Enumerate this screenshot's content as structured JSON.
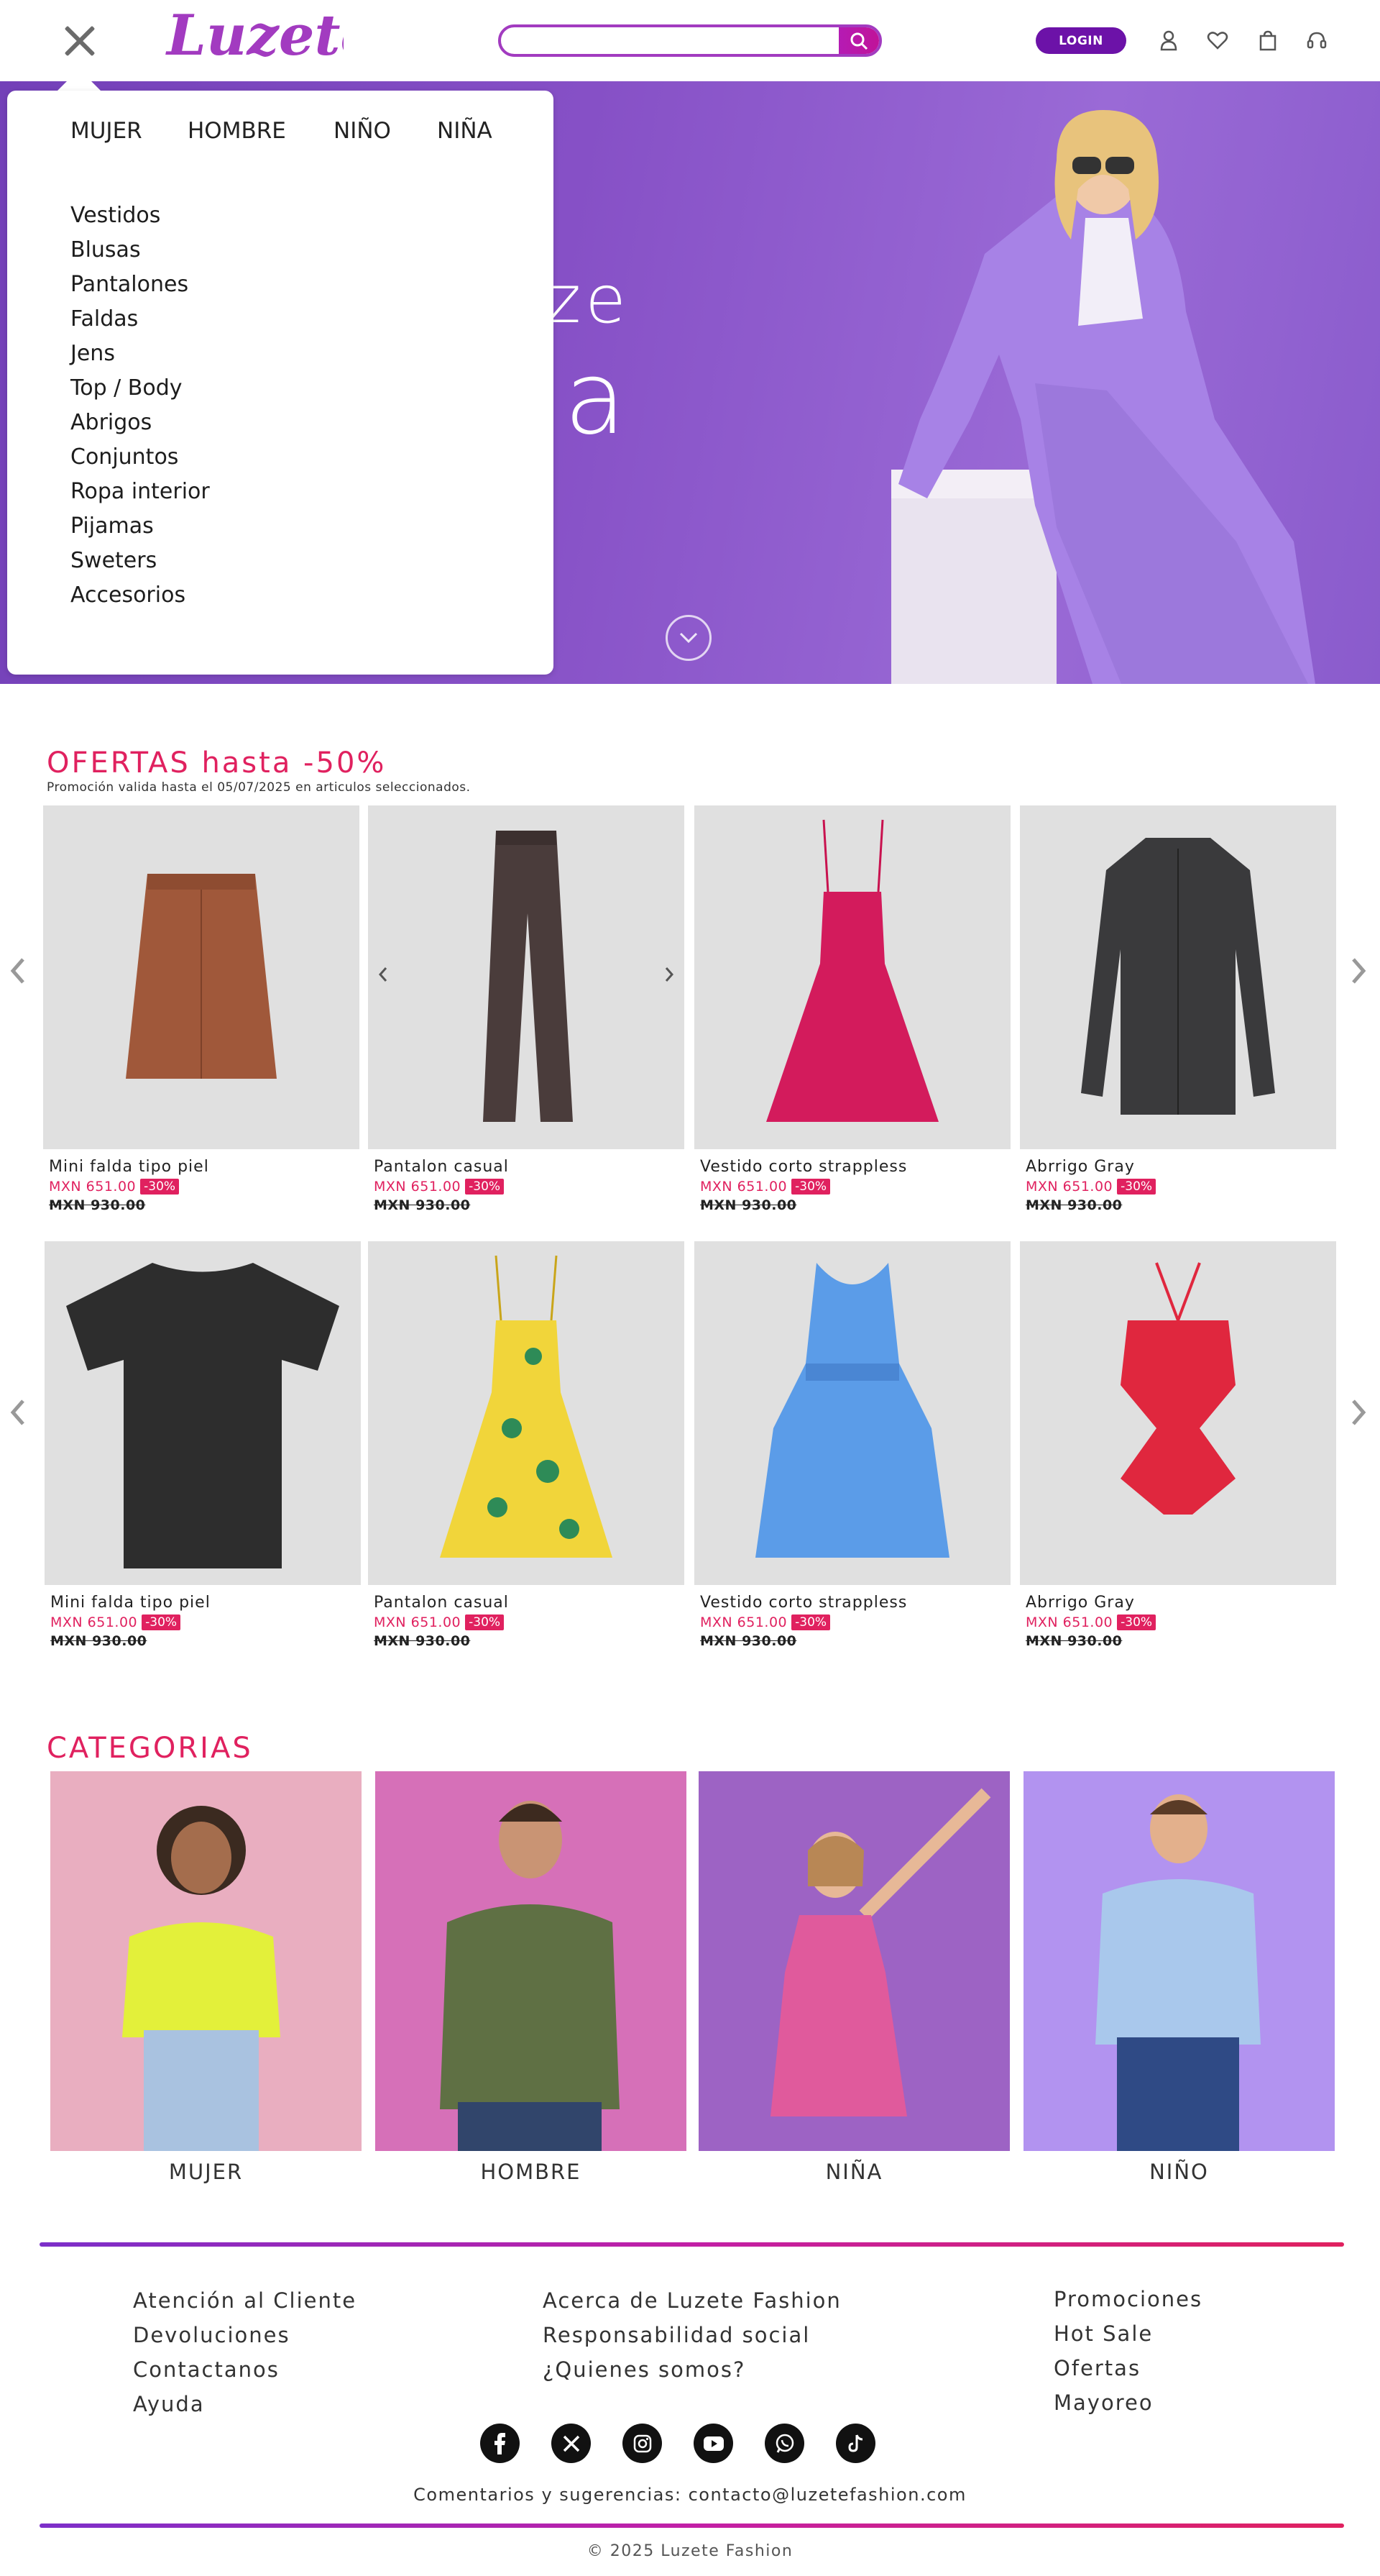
{
  "header": {
    "logo_text": "Luzete",
    "search": {
      "placeholder": "",
      "value": ""
    },
    "login_label": "LOGIN",
    "icons": [
      "user-icon",
      "heart-icon",
      "bag-icon",
      "headset-icon"
    ]
  },
  "hero": {
    "line1": "ze",
    "line2": "ia"
  },
  "menu": {
    "tabs": [
      "MUJER",
      "HOMBRE",
      "NIÑO",
      "NIÑA"
    ],
    "items": [
      "Vestidos",
      "Blusas",
      "Pantalones",
      "Faldas",
      "Jens",
      "Top / Body",
      "Abrigos",
      "Conjuntos",
      "Ropa interior",
      "Pijamas",
      "Sweters",
      "Accesorios"
    ]
  },
  "offers": {
    "title": "OFERTAS hasta -50%",
    "note": "Promoción valida hasta el 05/07/2025 en articulos seleccionados.",
    "row1": [
      {
        "name": "Mini falda tipo piel",
        "price": "MXN 651.00",
        "badge": "-30%",
        "old": "MXN 930.00"
      },
      {
        "name": "Pantalon casual",
        "price": "MXN 651.00",
        "badge": "-30%",
        "old": "MXN 930.00"
      },
      {
        "name": "Vestido corto strappless",
        "price": "MXN 651.00",
        "badge": "-30%",
        "old": "MXN 930.00"
      },
      {
        "name": "Abrrigo Gray",
        "price": "MXN 651.00",
        "badge": "-30%",
        "old": "MXN 930.00"
      }
    ],
    "row2": [
      {
        "name": "Mini falda tipo piel",
        "price": "MXN 651.00",
        "badge": "-30%",
        "old": "MXN 930.00"
      },
      {
        "name": "Pantalon casual",
        "price": "MXN 651.00",
        "badge": "-30%",
        "old": "MXN 930.00"
      },
      {
        "name": "Vestido corto strappless",
        "price": "MXN 651.00",
        "badge": "-30%",
        "old": "MXN 930.00"
      },
      {
        "name": "Abrrigo Gray",
        "price": "MXN 651.00",
        "badge": "-30%",
        "old": "MXN 930.00"
      }
    ]
  },
  "categories": {
    "title": "CATEGORIAS",
    "items": [
      "MUJER",
      "HOMBRE",
      "NIÑA",
      "NIÑO"
    ]
  },
  "footer": {
    "col1": [
      "Atención al Cliente",
      "Devoluciones",
      "Contactanos",
      "Ayuda"
    ],
    "col2": [
      "Acerca de Luzete Fashion",
      "Responsabilidad social",
      "¿Quienes somos?"
    ],
    "col3": [
      "Promociones",
      "Hot Sale",
      "Ofertas",
      "Mayoreo"
    ],
    "socials": [
      "facebook-icon",
      "x-icon",
      "instagram-icon",
      "youtube-icon",
      "whatsapp-icon",
      "tiktok-icon"
    ],
    "contact": "Comentarios y sugerencias: contacto@luzetefashion.com",
    "copyright": "© 2025 Luzete Fashion"
  },
  "colors": {
    "accent": "#e0215f",
    "brand": "#6c12a8",
    "logo": "#a23bc0",
    "hero_bg": "#8650c6"
  }
}
